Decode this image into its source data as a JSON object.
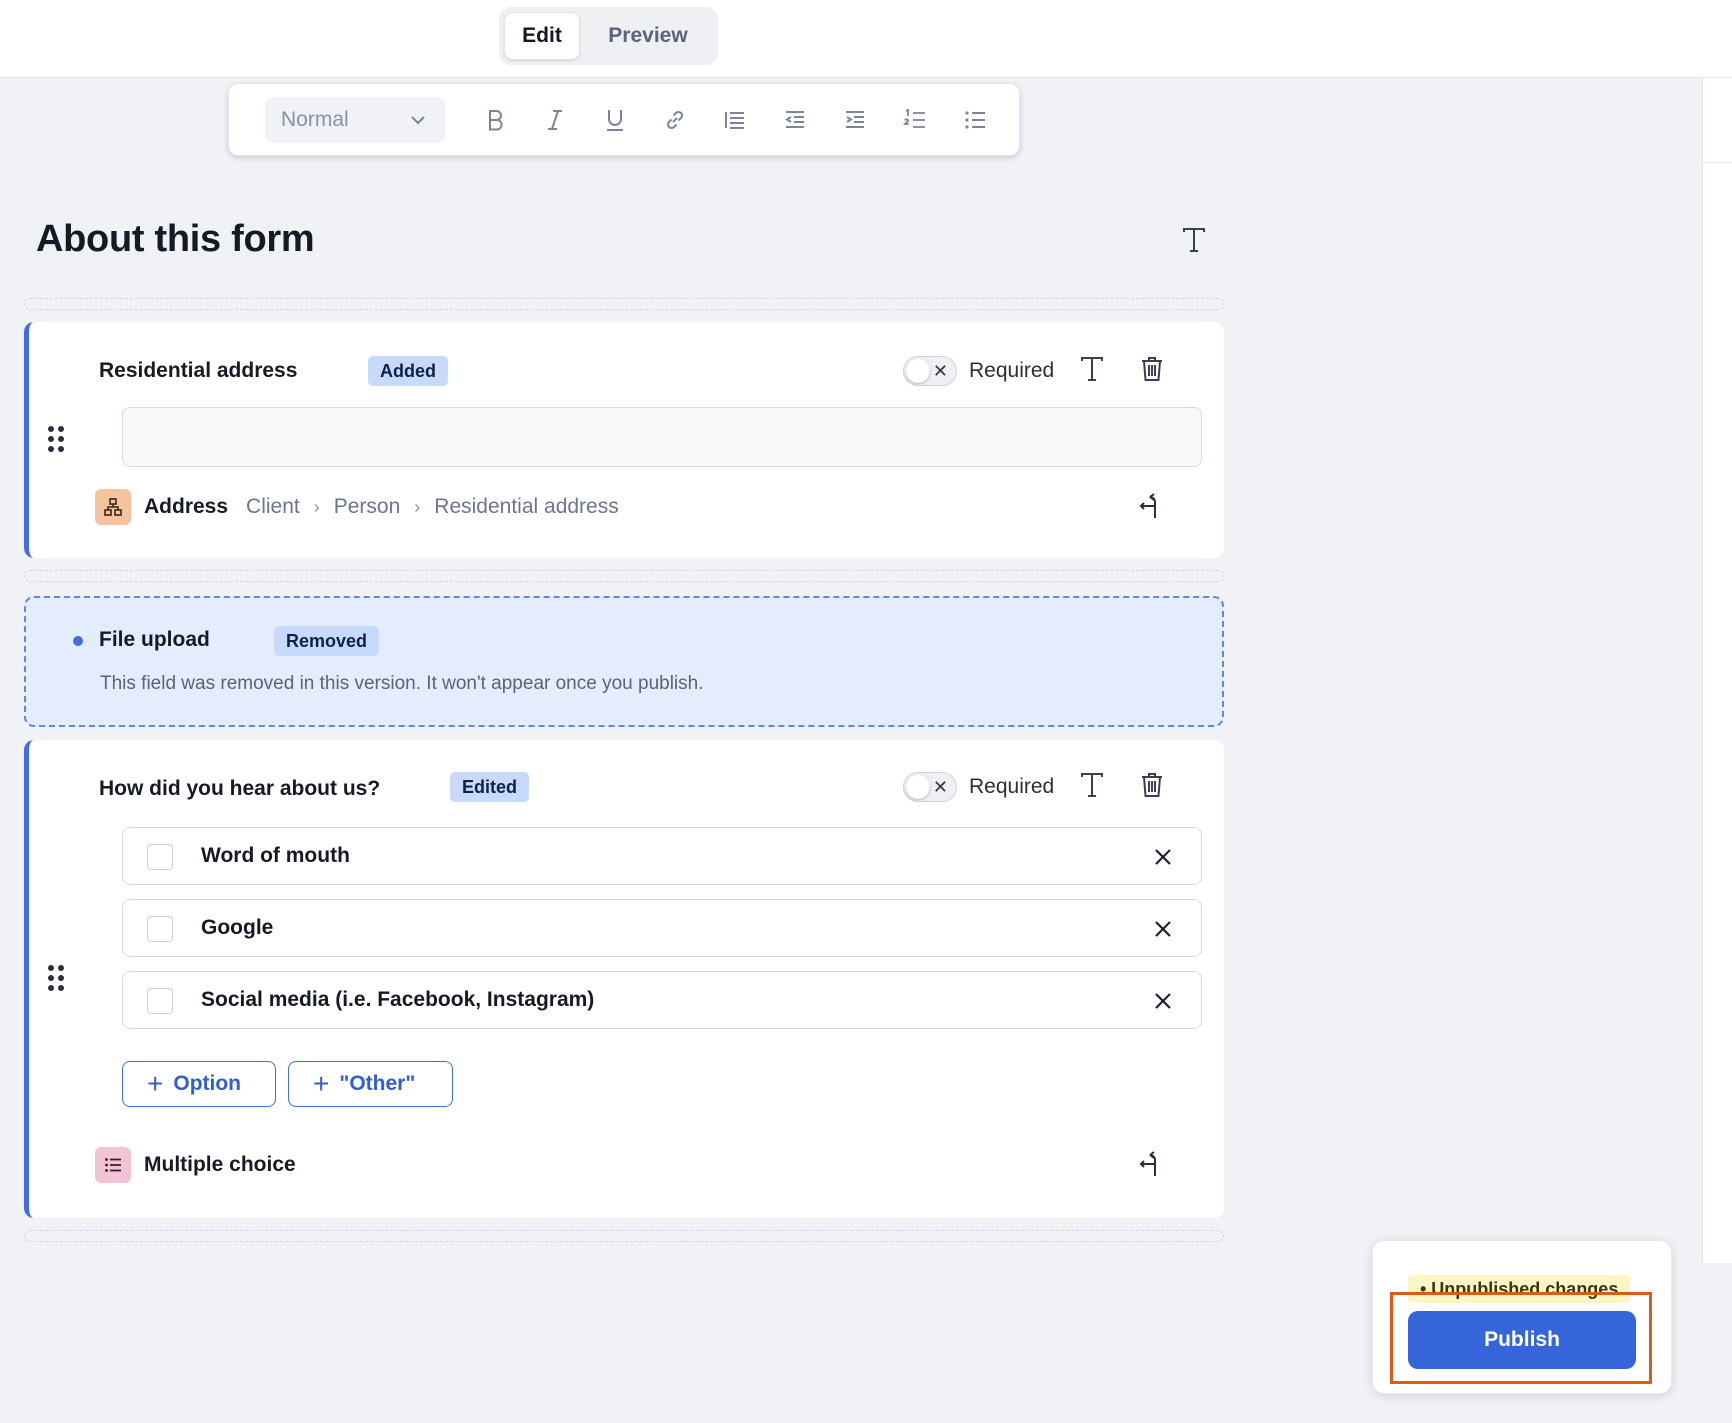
{
  "mode_switch": {
    "edit_label": "Edit",
    "preview_label": "Preview",
    "active": "Edit"
  },
  "toolbar": {
    "style_value": "Normal",
    "buttons": [
      "bold-icon",
      "italic-icon",
      "underline-icon",
      "link-icon",
      "align-left-icon",
      "outdent-icon",
      "indent-icon",
      "numbered-list-icon",
      "bullet-list-icon"
    ]
  },
  "form": {
    "title": "About this form"
  },
  "fields": {
    "residential": {
      "label": "Residential address",
      "badge": "Added",
      "required_label": "Required",
      "required": false,
      "input_value": "",
      "mapping": {
        "type": "Address",
        "path": [
          "Client",
          "Person",
          "Residential address"
        ]
      }
    },
    "file_upload": {
      "label": "File upload",
      "badge": "Removed",
      "note": "This field was removed in this version. It won't appear once you publish."
    },
    "hear_about": {
      "label": "How did you hear about us?",
      "badge": "Edited",
      "required_label": "Required",
      "required": false,
      "options": [
        "Word of mouth",
        "Google",
        "Social media (i.e. Facebook, Instagram)"
      ],
      "add_option_label": "Option",
      "add_other_label": "\"Other\"",
      "type_label": "Multiple choice"
    }
  },
  "publish": {
    "status": "• Unpublished changes",
    "button_label": "Publish"
  },
  "colors": {
    "accent": "#3e6fe0",
    "badge_bg": "#c8dafb",
    "publish": "#3565d8",
    "highlight": "#e05a16",
    "address_icon_bg": "#f3c49d",
    "choice_icon_bg": "#f2c4d6"
  }
}
